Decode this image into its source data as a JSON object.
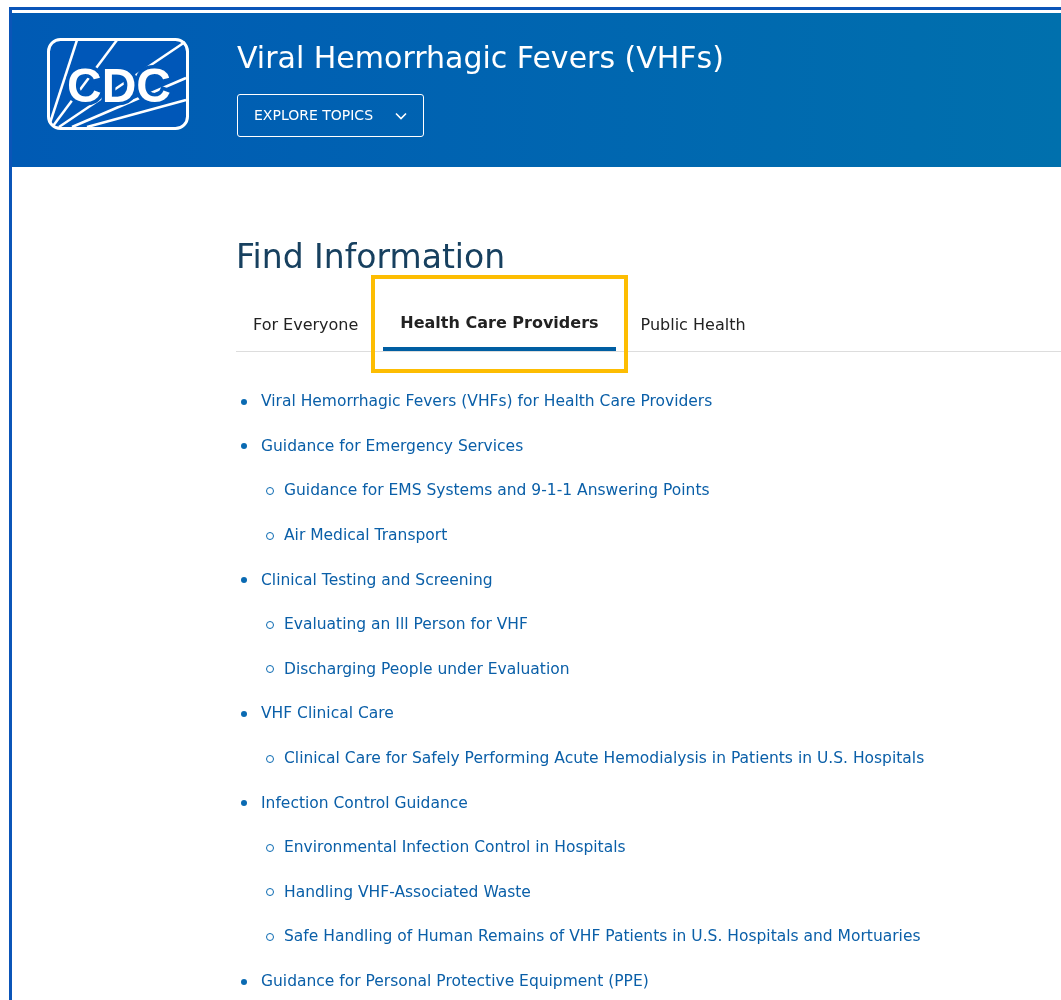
{
  "header": {
    "logo_text": "CDC",
    "title": "Viral Hemorrhagic Fevers (VHFs)",
    "explore_button": "EXPLORE TOPICS"
  },
  "section": {
    "heading": "Find Information",
    "tabs": [
      {
        "label": "For Everyone",
        "selected": false,
        "highlighted": false
      },
      {
        "label": "Health Care Providers",
        "selected": true,
        "highlighted": true
      },
      {
        "label": "Public Health",
        "selected": false,
        "highlighted": false
      }
    ],
    "links": [
      {
        "text": "Viral Hemorrhagic Fevers (VHFs) for Health Care Providers"
      },
      {
        "text": "Guidance for Emergency Services",
        "children": [
          {
            "text": "Guidance for EMS Systems and 9-1-1 Answering Points"
          },
          {
            "text": "Air Medical Transport"
          }
        ]
      },
      {
        "text": "Clinical Testing and Screening",
        "children": [
          {
            "text": "Evaluating an Ill Person for VHF"
          },
          {
            "text": "Discharging People under Evaluation"
          }
        ]
      },
      {
        "text": "VHF Clinical Care",
        "children": [
          {
            "text": "Clinical Care for Safely Performing Acute Hemodialysis in Patients in U.S. Hospitals"
          }
        ]
      },
      {
        "text": "Infection Control Guidance",
        "children": [
          {
            "text": "Environmental Infection Control in Hospitals"
          },
          {
            "text": "Handling VHF-Associated Waste"
          },
          {
            "text": "Safe Handling of Human Remains of VHF Patients in U.S. Hospitals and Mortuaries"
          }
        ]
      },
      {
        "text": "Guidance for Personal Protective Equipment (PPE)"
      }
    ]
  }
}
